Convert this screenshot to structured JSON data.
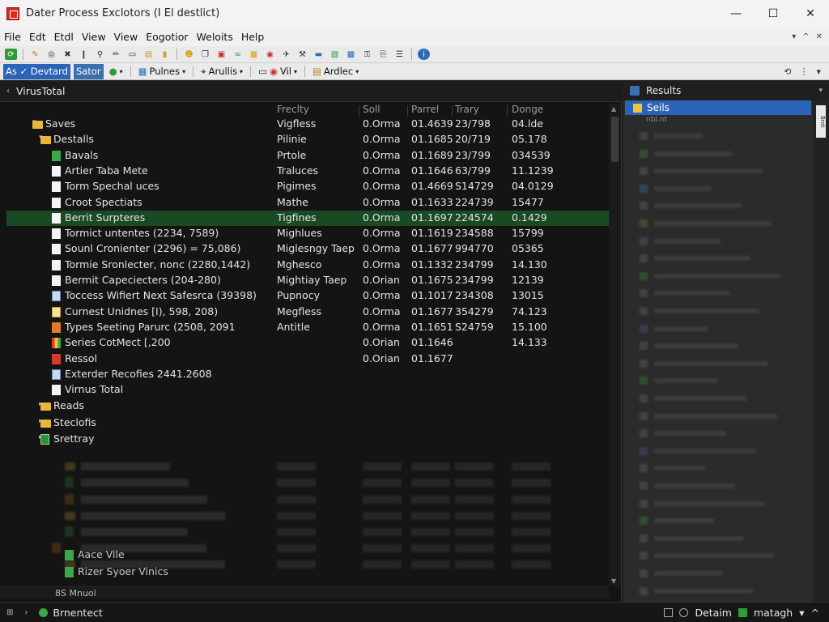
{
  "window": {
    "title": "Dater Process Exclotors (I El destlict)",
    "minimize": "—",
    "maximize": "☐",
    "close": "✕"
  },
  "menu": [
    "File",
    "Edt",
    "Etdl",
    "View",
    "View",
    "Eogotior",
    "Weloits",
    "Help"
  ],
  "menu_mdi": [
    "▾",
    "^",
    "✕"
  ],
  "toolbar2": {
    "group1": "As ✓ Devtard",
    "group1b": "Sator",
    "group2": "Pulnes",
    "group3": "Arullis",
    "group4": "Vil",
    "group5": "Ardlec"
  },
  "left_panel": {
    "header": "VirusTotal",
    "columns": [
      "Freclty",
      "Soll",
      "Parrel",
      "Trary",
      "Donge"
    ],
    "rows": [
      {
        "level": 1,
        "twisty": "▾",
        "icon": "folder",
        "name": "Saves",
        "c1": "Vigfless",
        "c2": "0.Orma",
        "c3": "01.4639",
        "c4": "23/798",
        "c5": "04.lde"
      },
      {
        "level": 2,
        "twisty": "▾",
        "icon": "folder",
        "name": "Destalls",
        "c1": "Pilinie",
        "c2": "0.Orma",
        "c3": "01.1685",
        "c4": "20/719",
        "c5": "05.178"
      },
      {
        "level": 3,
        "twisty": "",
        "icon": "green",
        "name": "Bavals",
        "c1": "Prtole",
        "c2": "0.Orma",
        "c3": "01.1689",
        "c4": "23/799",
        "c5": "034539"
      },
      {
        "level": 3,
        "twisty": "",
        "icon": "doc",
        "name": "Artier Taba Mete",
        "c1": "Traluces",
        "c2": "0.Orma",
        "c3": "01.1646",
        "c4": "63/799",
        "c5": "11.1239"
      },
      {
        "level": 3,
        "twisty": "",
        "icon": "doc",
        "name": "Torm Spechal uces",
        "c1": "Pigimes",
        "c2": "0.Orma",
        "c3": "01.4669",
        "c4": "S14729",
        "c5": "04.0129"
      },
      {
        "level": 3,
        "twisty": "",
        "icon": "doc",
        "name": "Croot Spectiats",
        "c1": "Mathe",
        "c2": "0.Orma",
        "c3": "01.1633",
        "c4": "224739",
        "c5": "15477"
      },
      {
        "level": 3,
        "twisty": "",
        "icon": "doc",
        "name": "Berrit Surpteres",
        "c1": "Tigfines",
        "c2": "0.Orma",
        "c3": "01.1697",
        "c4": "224574",
        "c5": "0.1429",
        "selected": true
      },
      {
        "level": 3,
        "twisty": "",
        "icon": "doc",
        "name": "Tormict untentes (2234, 7589)",
        "c1": "Mighlues",
        "c2": "0.Orma",
        "c3": "01.1619",
        "c4": "234588",
        "c5": "15799"
      },
      {
        "level": 3,
        "twisty": "",
        "icon": "doc",
        "name": "Sounl Cronienter (2296) = 75,086)",
        "c1": "Miglesngy Taep",
        "c2": "0.Orma",
        "c3": "01.1677",
        "c4": "994770",
        "c5": "05365"
      },
      {
        "level": 3,
        "twisty": "",
        "icon": "doc",
        "name": "Tormie Sronlecter, nonc (2280,1442)",
        "c1": "Mghesco",
        "c2": "0.Orma",
        "c3": "01.1332",
        "c4": "234799",
        "c5": "14.130"
      },
      {
        "level": 3,
        "twisty": "",
        "icon": "doc",
        "name": "Bermit Capeciecters (204-280)",
        "c1": "Mightiay Taep",
        "c2": "0.Orian",
        "c3": "01.1675",
        "c4": "234799",
        "c5": "12139"
      },
      {
        "level": 3,
        "twisty": "",
        "icon": "blueframe",
        "name": "Toccess Wifiert Next Safesrca (39398)",
        "c1": "Pupnocy",
        "c2": "0.Orma",
        "c3": "01.1017",
        "c4": "234308",
        "c5": "13015"
      },
      {
        "level": 3,
        "twisty": "",
        "icon": "yellowdoc",
        "name": "Curnest Unidnes [I), 598, 208)",
        "c1": "Megfless",
        "c2": "0.Orma",
        "c3": "01.1677",
        "c4": "354279",
        "c5": "74.123"
      },
      {
        "level": 3,
        "twisty": "",
        "icon": "orange",
        "name": "Types Seeting Parurc (2508, 2091",
        "c1": "Antitle",
        "c2": "0.Orma",
        "c3": "01.1651",
        "c4": "S24759",
        "c5": "15.100"
      },
      {
        "level": 3,
        "twisty": "",
        "icon": "multi",
        "name": "Series CotMect [,200",
        "c1": "",
        "c2": "0.Orian",
        "c3": "01.1646",
        "c4": "",
        "c5": "14.133"
      },
      {
        "level": 3,
        "twisty": "",
        "icon": "red",
        "name": "Ressol",
        "c1": "",
        "c2": "0.Orian",
        "c3": "01.1677",
        "c4": "",
        "c5": ""
      },
      {
        "level": 3,
        "twisty": "",
        "icon": "blueframe",
        "name": "Exterder Recofies 2441.2608",
        "c1": "",
        "c2": "",
        "c3": "",
        "c4": "",
        "c5": ""
      },
      {
        "level": 3,
        "twisty": "",
        "icon": "doc",
        "name": "Virnus Total",
        "c1": "",
        "c2": "",
        "c3": "",
        "c4": "",
        "c5": ""
      },
      {
        "level": 2,
        "twisty": "▸",
        "icon": "folder",
        "name": "Reads",
        "c1": "",
        "c2": "",
        "c3": "",
        "c4": "",
        "c5": ""
      },
      {
        "level": 2,
        "twisty": "▸",
        "icon": "folder",
        "name": "Steclofis",
        "c1": "",
        "c2": "",
        "c3": "",
        "c4": "",
        "c5": ""
      },
      {
        "level": 2,
        "twisty": "▸",
        "icon": "greenbox",
        "name": "Srettray",
        "c1": "",
        "c2": "",
        "c3": "",
        "c4": "",
        "c5": ""
      }
    ],
    "lower_rows": [
      {
        "level": 3,
        "twisty": "",
        "icon": "green",
        "name": "Aace Vile"
      },
      {
        "level": 3,
        "twisty": "",
        "icon": "green",
        "name": "Rizer Syoer Vinics"
      }
    ],
    "hscroll_label": "8S Mnuol"
  },
  "right_panel": {
    "header": "Results",
    "selected": "Seils",
    "sub": "nbl.nt",
    "vertical_label": "Brot"
  },
  "status": {
    "text": "Brnentect",
    "right1": "Detaim",
    "right2": "matagh",
    "right2_caret": "▾",
    "right_end": "^"
  },
  "colors": {
    "selection_green": "#1a4a24",
    "selection_blue": "#2a63b8"
  }
}
